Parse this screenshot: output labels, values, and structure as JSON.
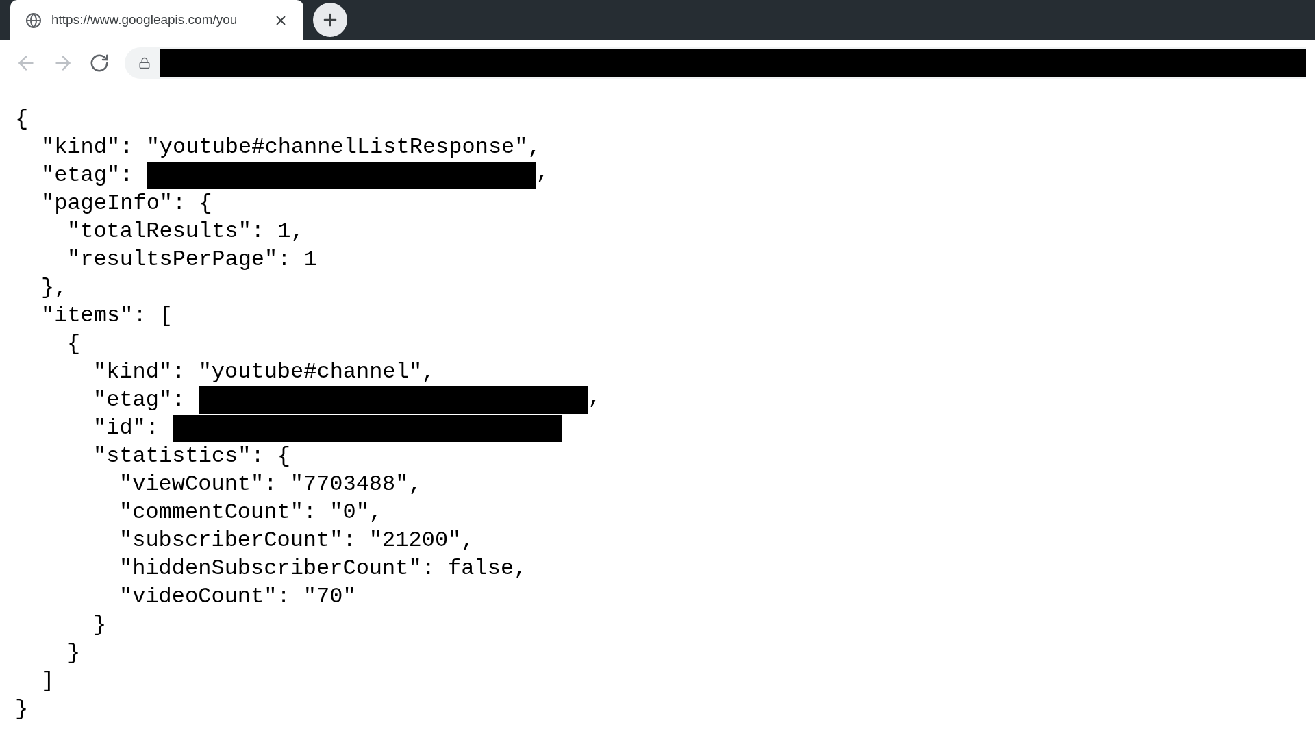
{
  "tab": {
    "title": "https://www.googleapis.com/you"
  },
  "document": {
    "lines": [
      {
        "text": "{",
        "children": [
          {
            "text": "\"kind\": \"youtube#channelListResponse\","
          },
          {
            "text": "\"etag\":",
            "redacted": true,
            "suffix": ","
          },
          {
            "text": "\"pageInfo\": {",
            "children": [
              {
                "text": "\"totalResults\": 1,"
              },
              {
                "text": "\"resultsPerPage\": 1"
              }
            ]
          },
          {
            "text": "},"
          },
          {
            "text": "\"items\": [",
            "children": [
              {
                "text": "{",
                "children": [
                  {
                    "text": "\"kind\": \"youtube#channel\","
                  },
                  {
                    "text": "\"etag\":",
                    "redacted": true,
                    "suffix": ","
                  },
                  {
                    "text": "\"id\":",
                    "redacted": true
                  },
                  {
                    "text": "\"statistics\": {",
                    "children": [
                      {
                        "text": "\"viewCount\": \"7703488\","
                      },
                      {
                        "text": "\"commentCount\": \"0\","
                      },
                      {
                        "text": "\"subscriberCount\": \"21200\","
                      },
                      {
                        "text": "\"hiddenSubscriberCount\": false,"
                      },
                      {
                        "text": "\"videoCount\": \"70\""
                      }
                    ]
                  },
                  {
                    "text": "}"
                  }
                ]
              },
              {
                "text": "}"
              }
            ]
          },
          {
            "text": "]"
          }
        ]
      },
      {
        "text": "}"
      }
    ]
  }
}
